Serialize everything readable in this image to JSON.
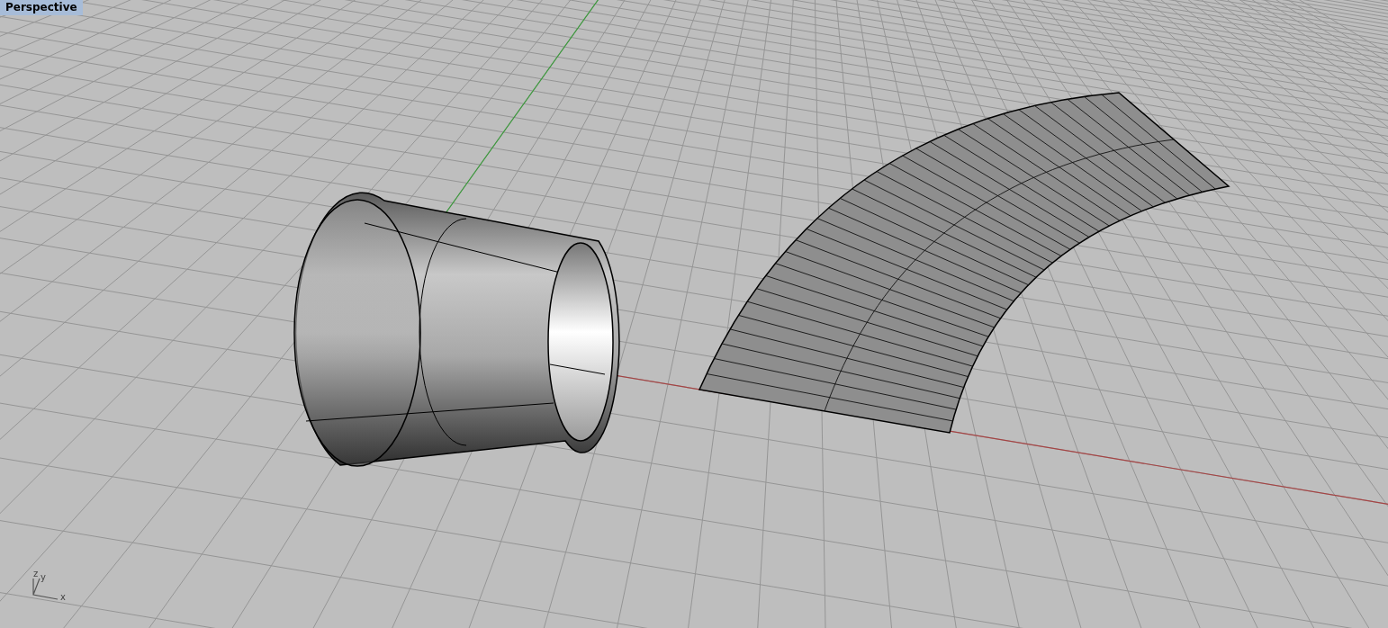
{
  "viewport": {
    "title": "Perspective"
  },
  "axis_icon": {
    "labels": [
      "z",
      "y",
      "x"
    ]
  }
}
